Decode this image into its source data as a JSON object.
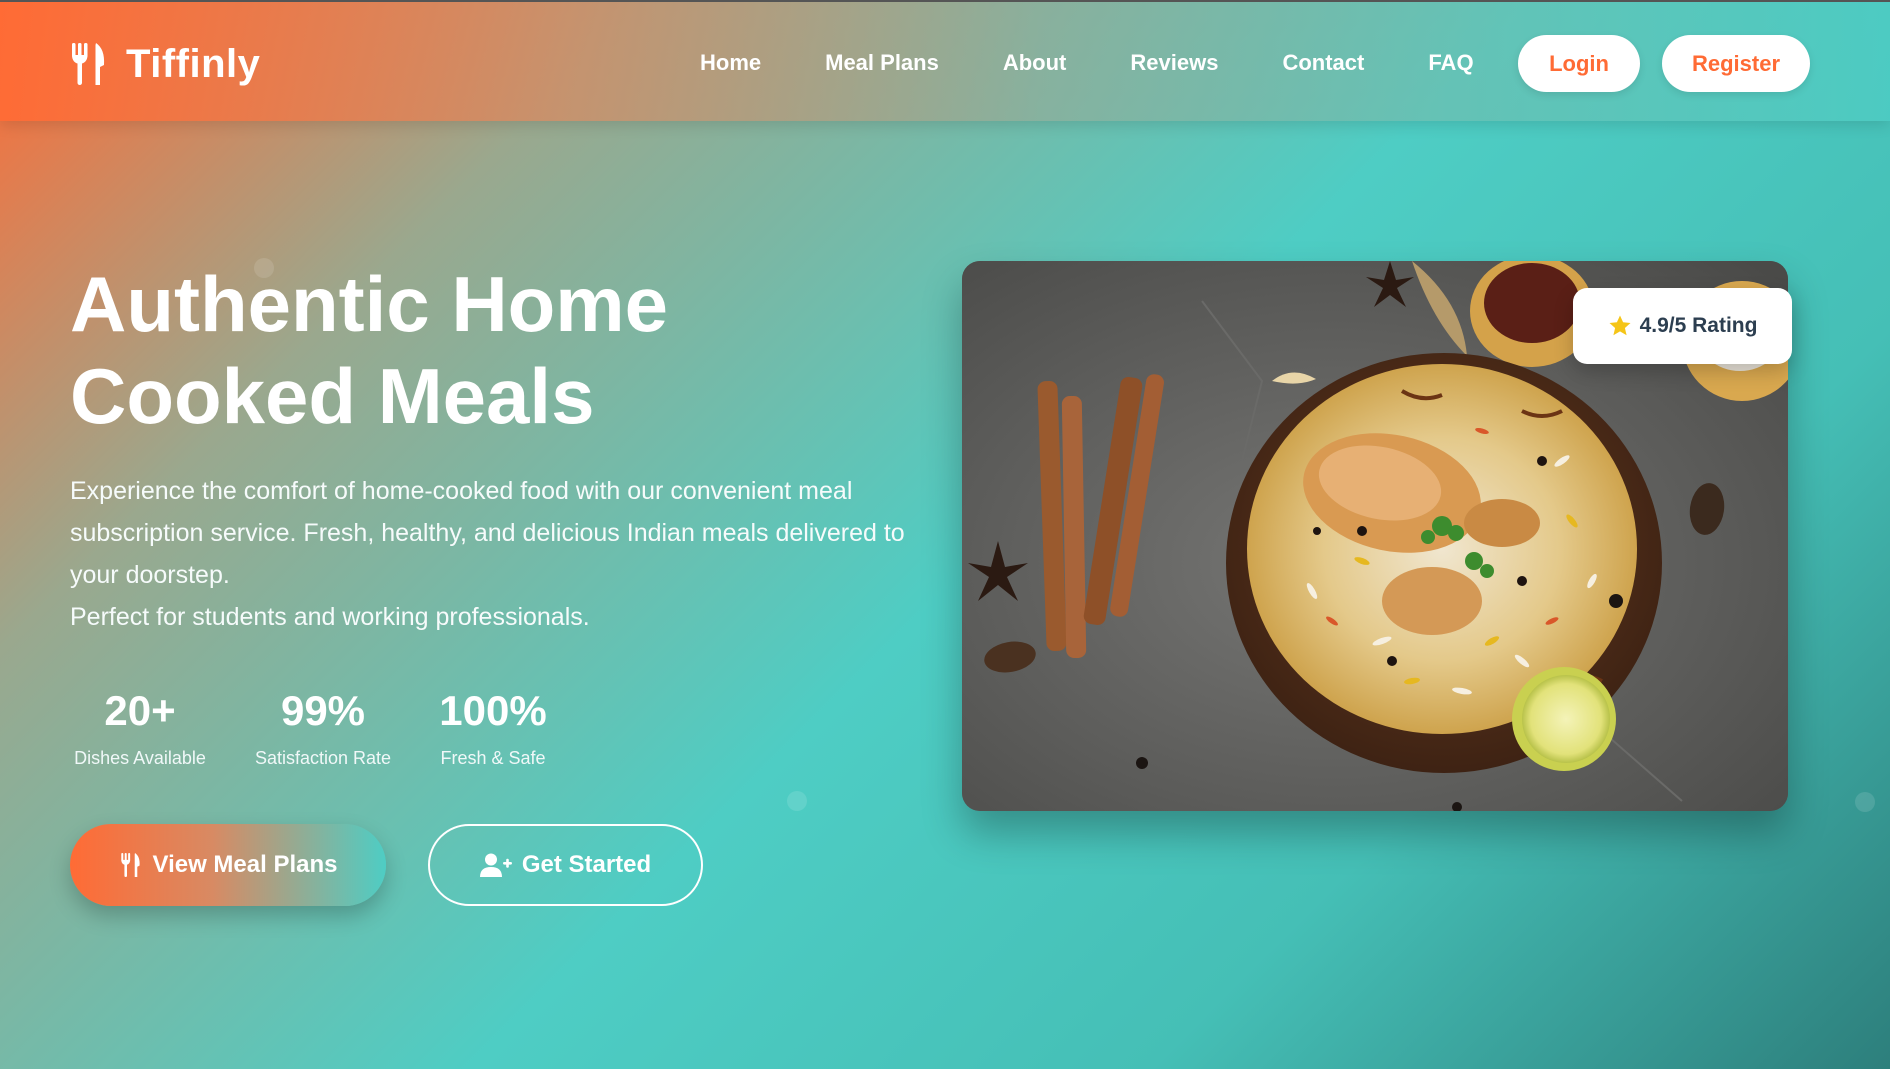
{
  "brand": {
    "name": "Tiffinly",
    "logo_icon": "utensils-icon"
  },
  "nav": {
    "links": [
      "Home",
      "Meal Plans",
      "About",
      "Reviews",
      "Contact",
      "FAQ"
    ],
    "login_label": "Login",
    "register_label": "Register"
  },
  "hero": {
    "title_line1": "Authentic Home",
    "title_line2": "Cooked Meals",
    "desc_line1": "Experience the comfort of home-cooked food with our convenient meal",
    "desc_line2": "subscription service. Fresh, healthy, and delicious Indian meals delivered to",
    "desc_line3": "your doorstep.",
    "desc_line4": "Perfect for students and working professionals.",
    "stats": [
      {
        "value": "20+",
        "label": "Dishes Available"
      },
      {
        "value": "99%",
        "label": "Satisfaction Rate"
      },
      {
        "value": "100%",
        "label": "Fresh & Safe"
      }
    ],
    "primary_button": {
      "label": "View Meal Plans",
      "icon": "utensils-icon"
    },
    "secondary_button": {
      "label": "Get Started",
      "icon": "user-plus-icon"
    },
    "image": {
      "subject": "biryani-bowl"
    },
    "rating_badge": {
      "label": "4.9/5 Rating",
      "icon": "star-icon"
    }
  },
  "colors": {
    "accent_orange": "#ff6b35",
    "accent_teal": "#4ecdc4",
    "star_yellow": "#f5c518",
    "badge_text": "#2c3e50"
  }
}
